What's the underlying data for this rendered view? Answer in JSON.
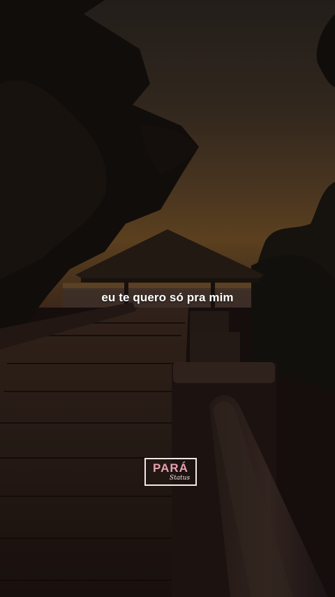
{
  "video": {
    "caption": "eu te quero só pra mim",
    "watermark": {
      "main": "PARÁ",
      "sub": "Status"
    }
  },
  "colors": {
    "sky_top": "#2d2520",
    "sky_horizon": "#6e4f28",
    "foliage": "#140f0c",
    "deck": "#2a1c17",
    "logo_pink": "#e8a0b0"
  }
}
